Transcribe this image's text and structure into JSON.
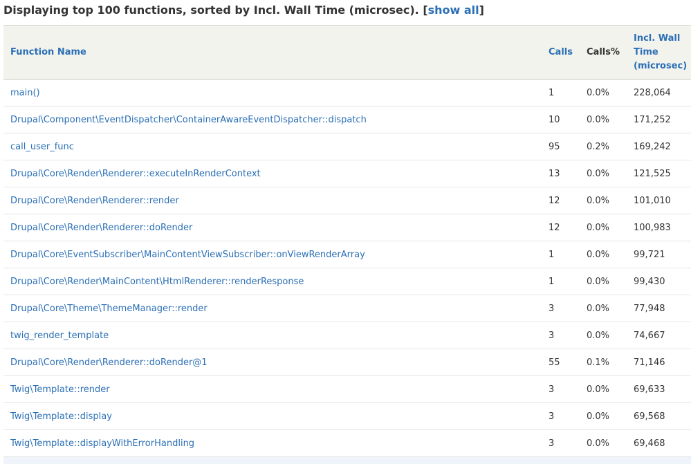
{
  "heading": {
    "prefix": "Displaying top 100 functions, sorted by Incl. Wall Time (microsec). [",
    "link_label": "show all",
    "suffix": "]"
  },
  "columns": {
    "function_name": "Function Name",
    "calls": "Calls",
    "calls_pct": "Calls%",
    "incl_wall_time": "Incl. Wall Time (microsec)"
  },
  "rows": [
    {
      "name": "main()",
      "calls": "1",
      "calls_pct": "0.0%",
      "wall": "228,064"
    },
    {
      "name": "Drupal\\Component\\EventDispatcher\\ContainerAwareEventDispatcher::dispatch",
      "calls": "10",
      "calls_pct": "0.0%",
      "wall": "171,252"
    },
    {
      "name": "call_user_func",
      "calls": "95",
      "calls_pct": "0.2%",
      "wall": "169,242"
    },
    {
      "name": "Drupal\\Core\\Render\\Renderer::executeInRenderContext",
      "calls": "13",
      "calls_pct": "0.0%",
      "wall": "121,525"
    },
    {
      "name": "Drupal\\Core\\Render\\Renderer::render",
      "calls": "12",
      "calls_pct": "0.0%",
      "wall": "101,010"
    },
    {
      "name": "Drupal\\Core\\Render\\Renderer::doRender",
      "calls": "12",
      "calls_pct": "0.0%",
      "wall": "100,983"
    },
    {
      "name": "Drupal\\Core\\EventSubscriber\\MainContentViewSubscriber::onViewRenderArray",
      "calls": "1",
      "calls_pct": "0.0%",
      "wall": "99,721"
    },
    {
      "name": "Drupal\\Core\\Render\\MainContent\\HtmlRenderer::renderResponse",
      "calls": "1",
      "calls_pct": "0.0%",
      "wall": "99,430"
    },
    {
      "name": "Drupal\\Core\\Theme\\ThemeManager::render",
      "calls": "3",
      "calls_pct": "0.0%",
      "wall": "77,948"
    },
    {
      "name": "twig_render_template",
      "calls": "3",
      "calls_pct": "0.0%",
      "wall": "74,667"
    },
    {
      "name": "Drupal\\Core\\Render\\Renderer::doRender@1",
      "calls": "55",
      "calls_pct": "0.1%",
      "wall": "71,146"
    },
    {
      "name": "Twig\\Template::render",
      "calls": "3",
      "calls_pct": "0.0%",
      "wall": "69,633"
    },
    {
      "name": "Twig\\Template::display",
      "calls": "3",
      "calls_pct": "0.0%",
      "wall": "69,568"
    },
    {
      "name": "Twig\\Template::displayWithErrorHandling",
      "calls": "3",
      "calls_pct": "0.0%",
      "wall": "69,468"
    }
  ]
}
